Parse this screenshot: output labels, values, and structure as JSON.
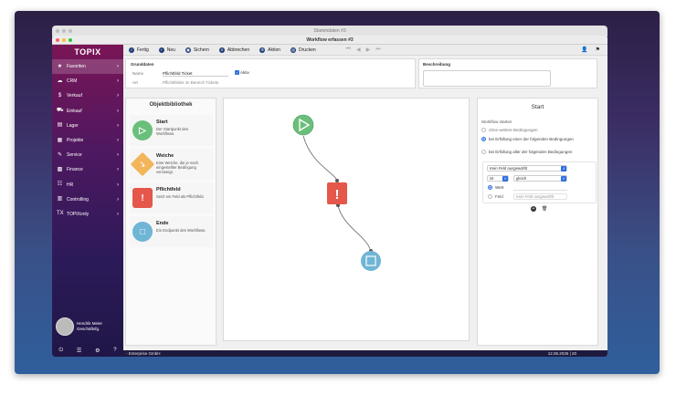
{
  "window": {
    "back_title": "Stammdaten #3",
    "title": "Workflow erfassen #3"
  },
  "sidebar": {
    "logo": "TOPIX",
    "items": [
      {
        "label": "Favoriten",
        "icon": "★",
        "active": true
      },
      {
        "label": "CRM",
        "icon": "☁"
      },
      {
        "label": "Verkauf",
        "icon": "$"
      },
      {
        "label": "Einkauf",
        "icon": "⛟"
      },
      {
        "label": "Lager",
        "icon": "▤"
      },
      {
        "label": "Projekte",
        "icon": "▦"
      },
      {
        "label": "Service",
        "icon": "✎"
      },
      {
        "label": "Finance",
        "icon": "▩"
      },
      {
        "label": "HR",
        "icon": "☷"
      },
      {
        "label": "Controlling",
        "icon": "▥"
      },
      {
        "label": "TOPIXonly",
        "icon": "TX"
      }
    ],
    "user_name": "Hendrik Meier",
    "user_role": "Geschäftsfg.",
    "bottom_icons": [
      "⏻",
      "☰",
      "⚙",
      "?"
    ]
  },
  "toolbar": {
    "buttons": [
      {
        "label": "Fertig",
        "icon": "✓"
      },
      {
        "label": "Neu",
        "icon": "+"
      },
      {
        "label": "Sichern",
        "icon": "▣"
      },
      {
        "label": "Abbrechen",
        "icon": "✕"
      },
      {
        "label": "Aktion",
        "icon": "⚙"
      },
      {
        "label": "Drucken",
        "icon": "▤"
      }
    ],
    "nav": [
      "⏮",
      "◀",
      "▶",
      "⏭"
    ],
    "right_icons": [
      "👤",
      "⚑"
    ]
  },
  "grunddaten": {
    "title": "Grunddaten",
    "name_label": "Name",
    "name_value": "Pflichtfeld Ticket",
    "active_label": "Aktiv",
    "art_label": "Art",
    "art_value": "Pflichtfelder im Bereich Tickets"
  },
  "beschreibung": {
    "title": "Beschreibung"
  },
  "library": {
    "title": "Objektbibliothek",
    "items": [
      {
        "name": "Start",
        "desc": "Der Startpunkt des Workflows.",
        "color": "#6abf7b",
        "icon": "▷"
      },
      {
        "name": "Weiche",
        "desc": "Eine Weiche, die je nach eingestellter Bedingung verzweigt.",
        "color": "#f2b55a",
        "icon": "⤳"
      },
      {
        "name": "Pflichtfeld",
        "desc": "Setzt ein Feld als Pflichtfeld.",
        "color": "#e4574a",
        "icon": "!"
      },
      {
        "name": "Ende",
        "desc": "Ein Endpunkt des Workflows.",
        "color": "#6fb5d6",
        "icon": "□"
      }
    ]
  },
  "properties": {
    "title": "Start",
    "section": "Workflow starten",
    "options": [
      {
        "label": "ohne weitere Bedingungen",
        "selected": false
      },
      {
        "label": "bei Erfüllung einer der folgenden Bedingungen",
        "selected": true
      },
      {
        "label": "bei Erfüllung aller der folgenden Bedingungen",
        "selected": false
      }
    ],
    "field_select": "Kein Feld ausgewählt",
    "op_select": "ist",
    "cmp_select": "gleich",
    "value_label": "Wert",
    "field_label": "Feld",
    "field2_select": "Kein Feld ausgewählt",
    "add_icon": "+",
    "delete_icon": "🗑"
  },
  "status": {
    "left": "- Enterprise GmbH",
    "right": "12.05.2026 | 20"
  }
}
